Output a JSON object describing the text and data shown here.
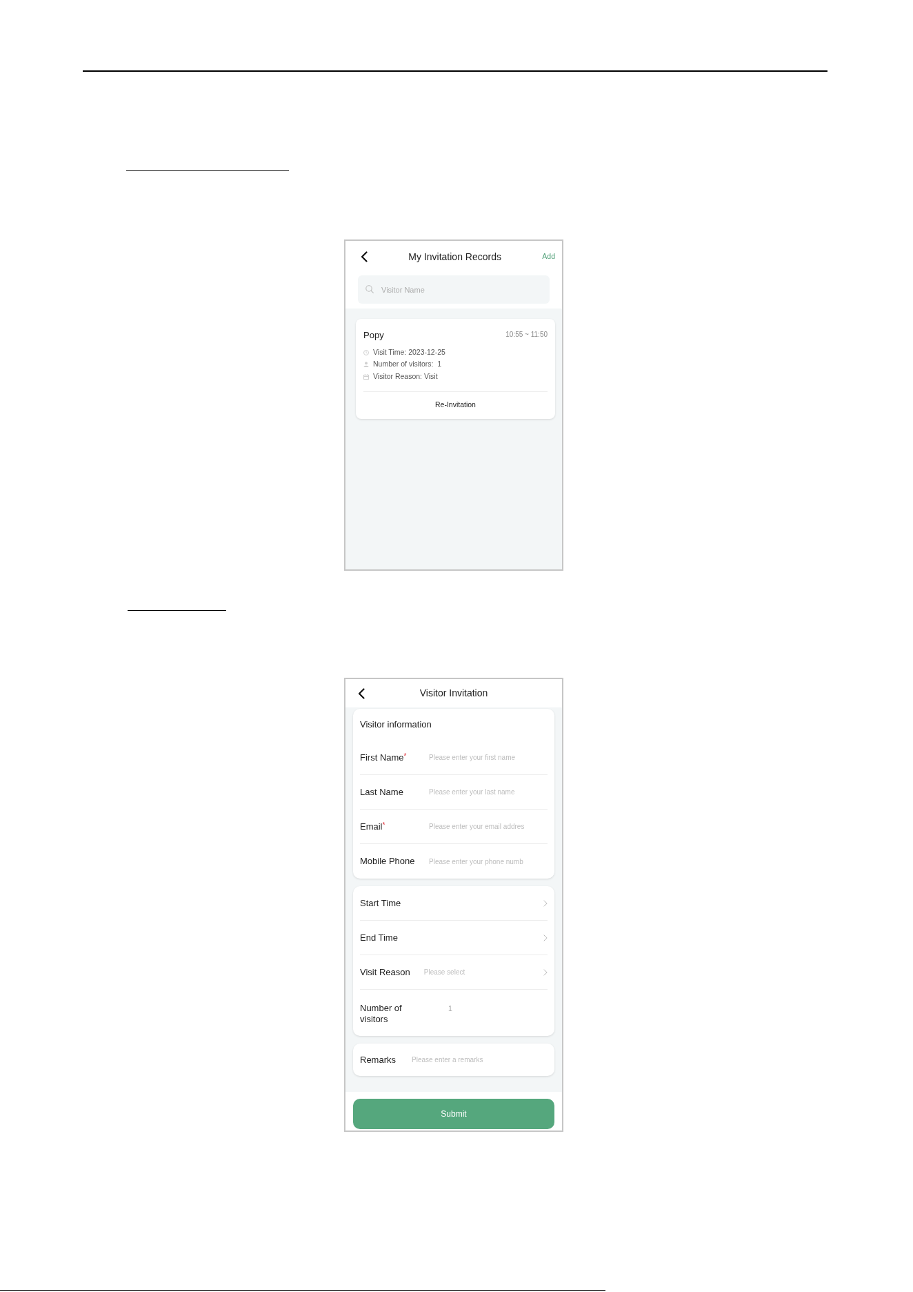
{
  "records_screen": {
    "title": "My Invitation Records",
    "add_action": "Add",
    "search": {
      "placeholder": "Visitor Name"
    },
    "records": [
      {
        "name": "Popy",
        "time_range": "10:55 ~ 11:50",
        "details": [
          {
            "kind": "clock",
            "text": "Visit Time: 2023-12-25"
          },
          {
            "kind": "person",
            "text": "Number of visitors:  1"
          },
          {
            "kind": "calendar",
            "text": "Visitor Reason: Visit"
          }
        ],
        "action": "Re-Invitation"
      }
    ]
  },
  "invitation_screen": {
    "title": "Visitor Invitation",
    "sections": [
      {
        "heading": "Visitor information",
        "fields": [
          {
            "kind": "text",
            "label": "First Name",
            "required_mark": "*",
            "placeholder": "Please enter your first name"
          },
          {
            "kind": "text",
            "label": "Last Name",
            "placeholder": "Please enter your last name"
          },
          {
            "kind": "text",
            "label": "Email",
            "required_mark": "*",
            "placeholder": "Please enter your email addres"
          },
          {
            "kind": "text",
            "label": "Mobile Phone",
            "placeholder": "Please enter your phone numb"
          }
        ]
      },
      {
        "fields": [
          {
            "kind": "picker",
            "label": "Start Time"
          },
          {
            "kind": "picker",
            "label": "End Time"
          },
          {
            "kind": "picker",
            "label": "Visit Reason",
            "placeholder": "Please select"
          },
          {
            "kind": "number",
            "label": "Number of visitors",
            "placeholder": "1"
          }
        ]
      },
      {
        "fields": [
          {
            "kind": "remark",
            "label": "Remarks",
            "placeholder": "Please enter a remarks"
          }
        ]
      }
    ],
    "submit": "Submit"
  }
}
